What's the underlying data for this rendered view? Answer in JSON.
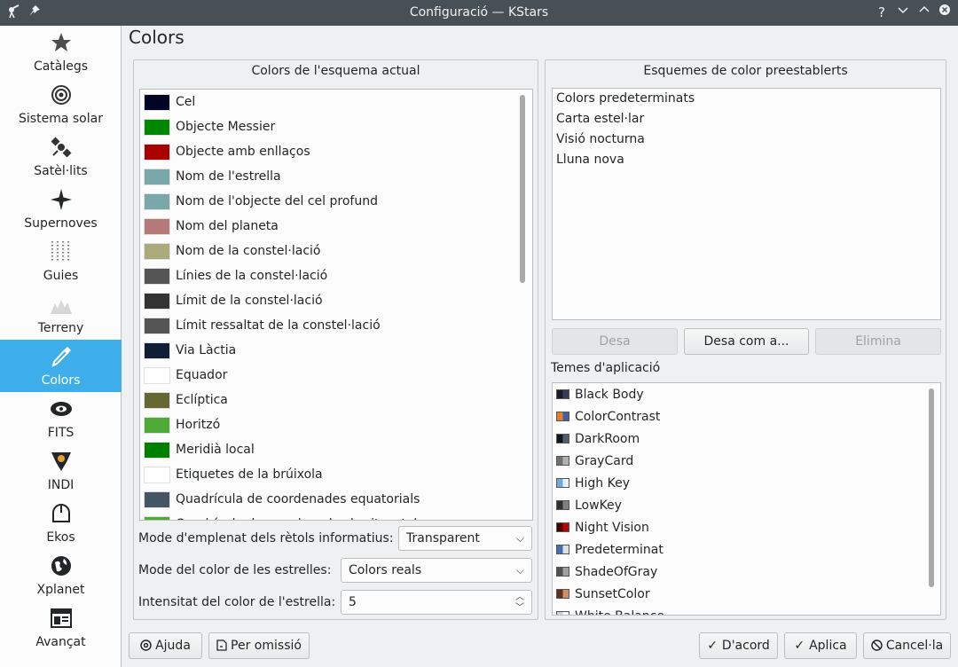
{
  "window": {
    "title": "Configuració — KStars"
  },
  "titlebar": {
    "help": "?",
    "min": "⌄",
    "max": "⌃",
    "close": "✕"
  },
  "sidebar": {
    "items": [
      {
        "label": "Catàlegs",
        "icon": "star-icon"
      },
      {
        "label": "Sistema solar",
        "icon": "solar-system-icon"
      },
      {
        "label": "Satèl·lits",
        "icon": "satellite-icon"
      },
      {
        "label": "Supernoves",
        "icon": "supernova-icon"
      },
      {
        "label": "Guies",
        "icon": "guides-icon"
      },
      {
        "label": "Terreny",
        "icon": "terrain-icon"
      },
      {
        "label": "Colors",
        "icon": "color-picker-icon",
        "active": true
      },
      {
        "label": "FITS",
        "icon": "fits-icon"
      },
      {
        "label": "INDI",
        "icon": "indi-icon"
      },
      {
        "label": "Ekos",
        "icon": "ekos-icon"
      },
      {
        "label": "Xplanet",
        "icon": "globe-icon"
      },
      {
        "label": "Avançat",
        "icon": "advanced-icon"
      }
    ]
  },
  "page": {
    "title": "Colors"
  },
  "current_scheme": {
    "title": "Colors de l'esquema actual",
    "items": [
      {
        "name": "Cel",
        "color": "#000523"
      },
      {
        "name": "Objecte Messier",
        "color": "#008800"
      },
      {
        "name": "Objecte amb enllaços",
        "color": "#aa0000"
      },
      {
        "name": "Nom de l'estrella",
        "color": "#7aa8aa"
      },
      {
        "name": "Nom de l'objecte del cel profund",
        "color": "#7aa8aa"
      },
      {
        "name": "Nom del planeta",
        "color": "#b37a78"
      },
      {
        "name": "Nom de la constel·lació",
        "color": "#aaaa7a"
      },
      {
        "name": "Línies de la constel·lació",
        "color": "#555555"
      },
      {
        "name": "Límit de la constel·lació",
        "color": "#333333"
      },
      {
        "name": "Límit ressaltat de la constel·lació",
        "color": "#555555"
      },
      {
        "name": "Via Làctia",
        "color": "#0f1e35"
      },
      {
        "name": "Equador",
        "color": "#ffffff"
      },
      {
        "name": "Eclíptica",
        "color": "#666633"
      },
      {
        "name": "Horitzó",
        "color": "#4eaa34"
      },
      {
        "name": "Meridià local",
        "color": "#008000"
      },
      {
        "name": "Etiquetes de la brúixola",
        "color": "#ffffff"
      },
      {
        "name": "Quadrícula de coordenades equatorials",
        "color": "#445566"
      },
      {
        "name": "Quadrícula de coordenades horitzontals",
        "color": "#4eaa34"
      }
    ]
  },
  "form": {
    "infobox_label": "Mode d'emplenat dels rètols informatius:",
    "infobox_value": "Transparent",
    "star_color_label": "Mode del color de les estrelles:",
    "star_color_value": "Colors reals",
    "intensity_label": "Intensitat del color de l'estrella:",
    "intensity_value": "5"
  },
  "presets": {
    "title": "Esquemes de color preestablerts",
    "items": [
      "Colors predeterminats",
      "Carta estel·lar",
      "Visió nocturna",
      "Lluna nova"
    ],
    "save": "Desa",
    "save_as": "Desa com a...",
    "delete": "Elimina"
  },
  "themes": {
    "label": "Temes d'aplicació",
    "items": [
      "Black Body",
      "ColorContrast",
      "DarkRoom",
      "GrayCard",
      "High Key",
      "LowKey",
      "Night Vision",
      "Predeterminat",
      "ShadeOfGray",
      "SunsetColor",
      "White Balance"
    ]
  },
  "footer": {
    "help": "Ajuda",
    "defaults": "Per omissió",
    "ok": "D'acord",
    "apply": "Aplica",
    "cancel": "Cancel·la"
  }
}
